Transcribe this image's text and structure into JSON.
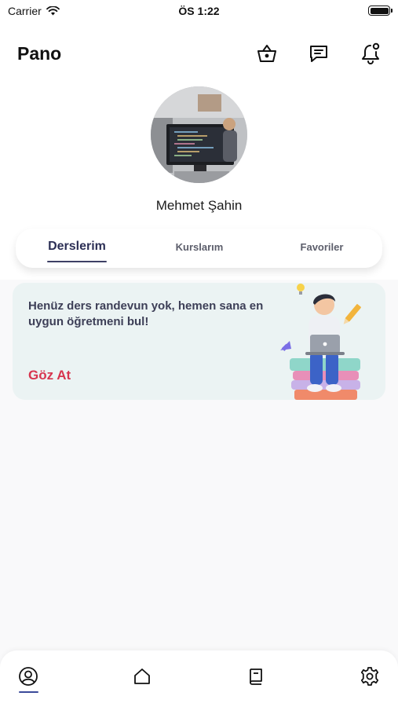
{
  "status_bar": {
    "carrier": "Carrier",
    "time": "ÖS 1:22"
  },
  "header": {
    "title": "Pano",
    "icons": [
      "basket-icon",
      "chat-icon",
      "bell-icon"
    ]
  },
  "profile": {
    "name": "Mehmet Şahin"
  },
  "tabs": [
    {
      "label": "Derslerim",
      "active": true
    },
    {
      "label": "Kurslarım",
      "active": false
    },
    {
      "label": "Favoriler",
      "active": false
    }
  ],
  "banner": {
    "message": "Henüz ders randevun yok, hemen sana en uygun öğretmeni bul!",
    "cta": "Göz At"
  },
  "bottom_nav": {
    "items": [
      "profile-icon",
      "home-icon",
      "book-icon",
      "settings-icon"
    ],
    "active_index": 0
  },
  "colors": {
    "accent": "#d7354f",
    "tab_active": "#2c2f55",
    "banner_bg": "#ebf3f3",
    "nav_indicator": "#3b4a9a"
  }
}
